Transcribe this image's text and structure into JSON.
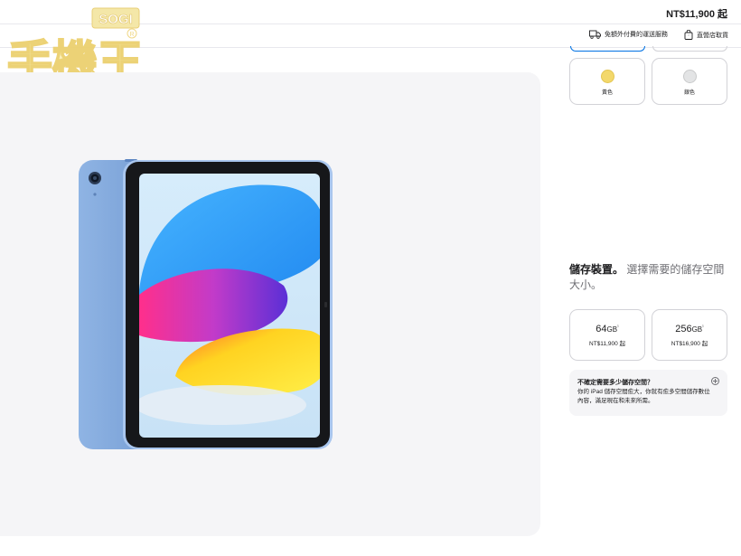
{
  "header": {
    "price_from": "NT$11,900 起"
  },
  "delivery": {
    "ship_label": "免額外付費的運送服務",
    "pickup_label": "直營店取貨"
  },
  "watermark": {
    "badge": "SOGI",
    "text": "手機王"
  },
  "colors": [
    {
      "label": "黃色",
      "swatch": "#f3d86b"
    },
    {
      "label": "銀色",
      "swatch": "#e3e4e5"
    }
  ],
  "storage": {
    "heading_strong": "儲存裝置。",
    "heading_rest": "選擇需要的儲存空間大小。",
    "options": [
      {
        "capacity": "64",
        "unit": "GB",
        "footnote": "¹",
        "price": "NT$11,900 起"
      },
      {
        "capacity": "256",
        "unit": "GB",
        "footnote": "¹",
        "price": "NT$16,900 起"
      }
    ],
    "help": {
      "title": "不確定需要多少儲存空間？",
      "body": "你的 iPad 儲存空間愈大，你就有愈多空間儲存數位內容，滿足現在和未來所需。"
    }
  },
  "accent_color": "#0071e3",
  "product_color": "#7fa6d8"
}
